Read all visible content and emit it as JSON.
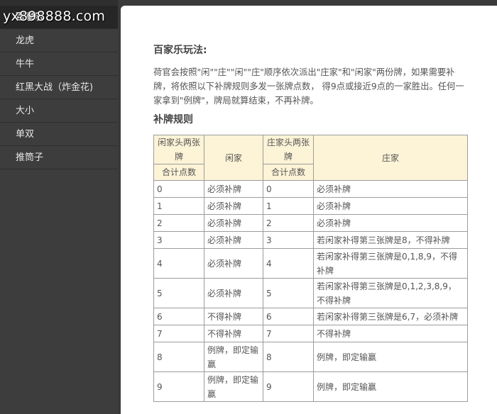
{
  "watermark": "yx898888.com",
  "sidebar": {
    "items": [
      {
        "label": "百家乐",
        "active": true
      },
      {
        "label": "龙虎"
      },
      {
        "label": "牛牛"
      },
      {
        "label": "红黑大战（炸金花)"
      },
      {
        "label": "大小"
      },
      {
        "label": "单双"
      },
      {
        "label": "推筒子"
      }
    ]
  },
  "main": {
    "title": "百家乐玩法:",
    "paragraph": "荷官会按照\"闲\"\"庄\"\"闲\"\"庄\"顺序依次派出\"庄家\"和\"闲家\"两份牌，如果需要补牌，将依照以下补牌规则多发一张牌点数， 得9点或接近9点的一家胜出。任何一家拿到\"例牌\"，牌局就算结束，不再补牌。",
    "rules_title": "补牌规则",
    "table": {
      "headers": {
        "player_first_two": "闲家头两张牌",
        "player_total": "合计点数",
        "player": "闲家",
        "banker_first_two": "庄家头两张牌",
        "banker_total": "合计点数",
        "banker": "庄家"
      },
      "rows": [
        {
          "p_pts": "0",
          "p_action": "必须补牌",
          "b_pts": "0",
          "b_action": "必须补牌"
        },
        {
          "p_pts": "1",
          "p_action": "必须补牌",
          "b_pts": "1",
          "b_action": "必须补牌"
        },
        {
          "p_pts": "2",
          "p_action": "必须补牌",
          "b_pts": "2",
          "b_action": "必须补牌"
        },
        {
          "p_pts": "3",
          "p_action": "必须补牌",
          "b_pts": "3",
          "b_action": "若闲家补得第三张牌是8，不得补牌"
        },
        {
          "p_pts": "4",
          "p_action": "必须补牌",
          "b_pts": "4",
          "b_action": "若闲家补得第三张牌是0,1,8,9，不得补牌"
        },
        {
          "p_pts": "5",
          "p_action": "必须补牌",
          "b_pts": "5",
          "b_action": "若闲家补得第三张牌是0,1,2,3,8,9，不得补牌"
        },
        {
          "p_pts": "6",
          "p_action": "不得补牌",
          "b_pts": "6",
          "b_action": "若闲家补得第三张牌是6,7，必须补牌"
        },
        {
          "p_pts": "7",
          "p_action": "不得补牌",
          "b_pts": "7",
          "b_action": "不得补牌"
        },
        {
          "p_pts": "8",
          "p_action": "例牌，即定输赢",
          "b_pts": "8",
          "b_action": "例牌，即定输赢"
        },
        {
          "p_pts": "9",
          "p_action": "例牌，即定输赢",
          "b_pts": "9",
          "b_action": "例牌，即定输赢"
        }
      ]
    }
  }
}
